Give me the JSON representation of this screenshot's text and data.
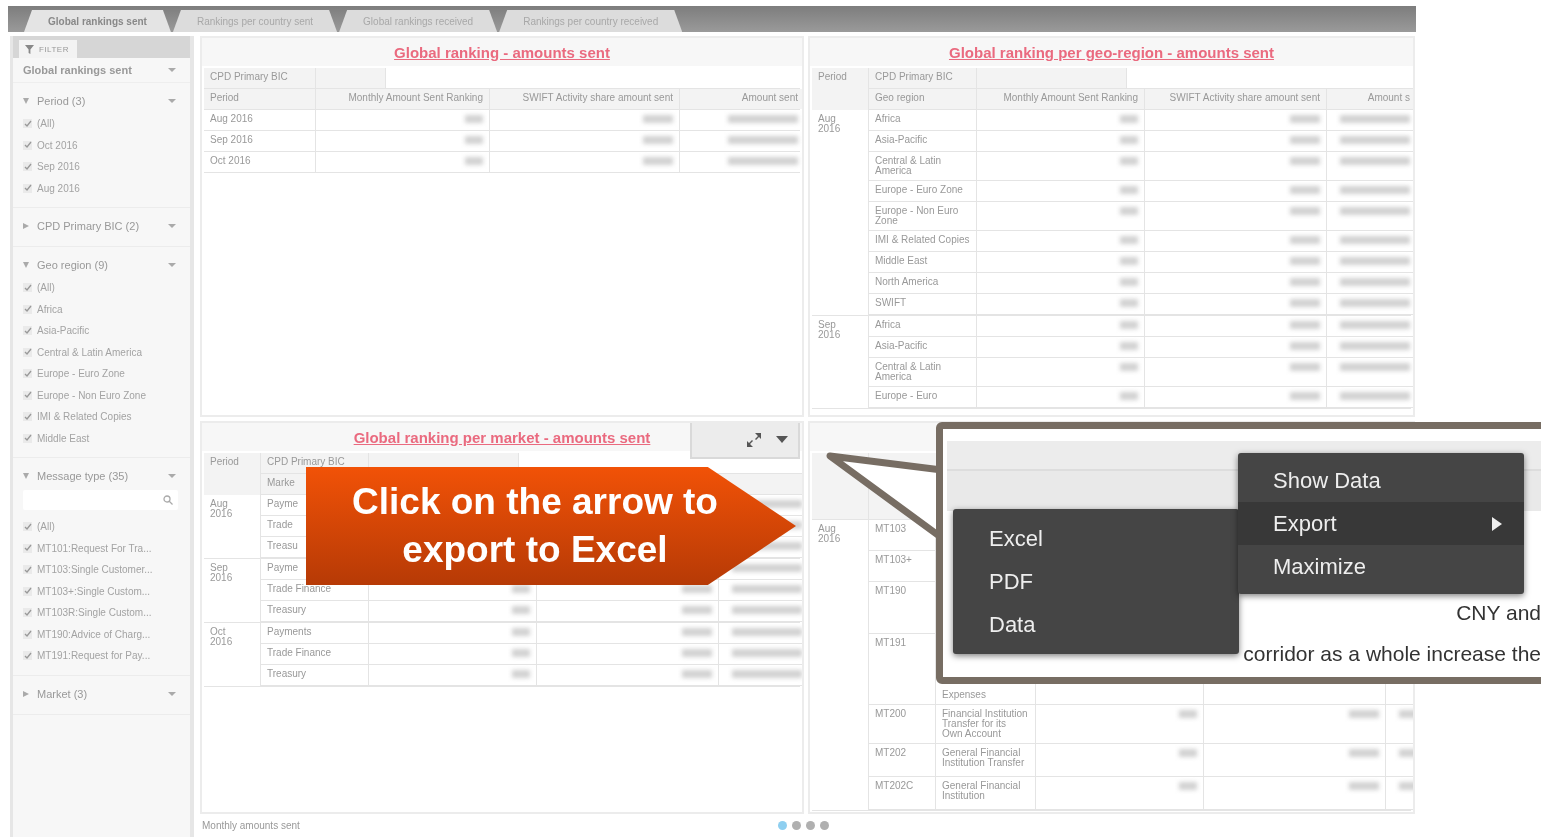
{
  "tabs": [
    {
      "label": "Global rankings sent",
      "selected": true
    },
    {
      "label": "Rankings per country sent",
      "selected": false
    },
    {
      "label": "Global rankings received",
      "selected": false
    },
    {
      "label": "Rankings per country received",
      "selected": false
    }
  ],
  "filter": {
    "tab_label": "FILTER",
    "title": "Global rankings sent"
  },
  "filter_groups": [
    {
      "title": "Period (3)",
      "expanded": true,
      "items": [
        {
          "label": "(All)",
          "checked": true
        },
        {
          "label": "Oct 2016",
          "checked": true
        },
        {
          "label": "Sep 2016",
          "checked": true
        },
        {
          "label": "Aug 2016",
          "checked": true
        }
      ]
    },
    {
      "title": "CPD Primary BIC (2)",
      "expanded": false
    },
    {
      "title": "Geo region (9)",
      "expanded": true,
      "items": [
        {
          "label": "(All)",
          "checked": true
        },
        {
          "label": "Africa",
          "checked": true
        },
        {
          "label": "Asia-Pacific",
          "checked": true
        },
        {
          "label": "Central & Latin America",
          "checked": true
        },
        {
          "label": "Europe - Euro Zone",
          "checked": true
        },
        {
          "label": "Europe - Non Euro Zone",
          "checked": true
        },
        {
          "label": "IMI & Related Copies",
          "checked": true
        },
        {
          "label": "Middle East",
          "checked": true
        }
      ]
    },
    {
      "title": "Message type (35)",
      "expanded": true,
      "searchable": true,
      "items": [
        {
          "label": "(All)",
          "checked": true
        },
        {
          "label": "MT101:Request For Tra...",
          "checked": true
        },
        {
          "label": "MT103:Single Customer...",
          "checked": true
        },
        {
          "label": "MT103+:Single Custom...",
          "checked": true
        },
        {
          "label": "MT103R:Single Custom...",
          "checked": true
        },
        {
          "label": "MT190:Advice of Charg...",
          "checked": true
        },
        {
          "label": "MT191:Request for Pay...",
          "checked": true
        }
      ]
    },
    {
      "title": "Market (3)",
      "expanded": false
    }
  ],
  "panels": [
    {
      "kind": "simple",
      "title": "Global ranking - amounts sent",
      "bic_label": "CPD Primary BIC",
      "columns": [
        "Period",
        "Monthly Amount Sent Ranking",
        "SWIFT Activity share amount sent",
        "Amount sent"
      ],
      "rows": [
        "Aug 2016",
        "Sep 2016",
        "Oct 2016"
      ]
    },
    {
      "kind": "grouped",
      "title": "Global ranking per geo-region - amounts sent",
      "columns": [
        "Period",
        "CPD Primary BIC",
        "Geo region"
      ],
      "metric_headers": [
        "Monthly Amount Sent Ranking",
        "SWIFT Activity share amount sent",
        "Amount s"
      ],
      "groups": [
        {
          "period": "Aug 2016",
          "rows": [
            "Africa",
            "Asia-Pacific",
            "Central & Latin America",
            "Europe - Euro Zone",
            "Europe - Non Euro Zone",
            "IMI & Related Copies",
            "Middle East",
            "North America",
            "SWIFT"
          ]
        },
        {
          "period": "Sep 2016",
          "rows": [
            "Africa",
            "Asia-Pacific",
            "Central & Latin America",
            "Europe - Euro"
          ]
        }
      ]
    },
    {
      "kind": "grouped",
      "title": "Global ranking per market - amounts sent",
      "toolbar": true,
      "columns": [
        "Period",
        "CPD Primary BIC",
        "Marke"
      ],
      "groups": [
        {
          "period": "Aug 2016",
          "rows": [
            "Payme",
            "Trade",
            "Treasu"
          ]
        },
        {
          "period": "Sep 2016",
          "rows": [
            "Payme",
            "Trade Finance",
            "Treasury"
          ]
        },
        {
          "period": "Oct 2016",
          "rows": [
            "Payments",
            "Trade Finance",
            "Treasury"
          ]
        }
      ]
    },
    {
      "kind": "message",
      "groups": [
        {
          "period": "Aug 2016",
          "rows": [
            {
              "code": "MT103"
            },
            {
              "code": "MT103+"
            },
            {
              "code": "MT190"
            },
            {
              "code": "MT191",
              "desc": "Expenses"
            },
            {
              "code": "MT200",
              "desc": "Financial Institution Transfer for its Own Account"
            },
            {
              "code": "MT202",
              "desc": "General Financial Institution Transfer"
            },
            {
              "code": "MT202C",
              "desc": "General Financial Institution"
            }
          ]
        }
      ]
    }
  ],
  "footer": {
    "label": "Monthly amounts sent",
    "pages": [
      {
        "selected": true
      },
      {
        "selected": false
      },
      {
        "selected": false
      },
      {
        "selected": false
      }
    ]
  },
  "banner": {
    "text": "Click on the arrow to export to Excel"
  },
  "zoom_callout": {
    "text_lines": [
      "CNY and",
      "corridor as a whole increase the"
    ],
    "menu": [
      {
        "label": "Show Data",
        "highlighted": false,
        "submenu": false
      },
      {
        "label": "Export",
        "highlighted": true,
        "submenu": true
      },
      {
        "label": "Maximize",
        "highlighted": false,
        "submenu": false
      }
    ],
    "submenu": [
      "Excel",
      "PDF",
      "Data"
    ]
  }
}
